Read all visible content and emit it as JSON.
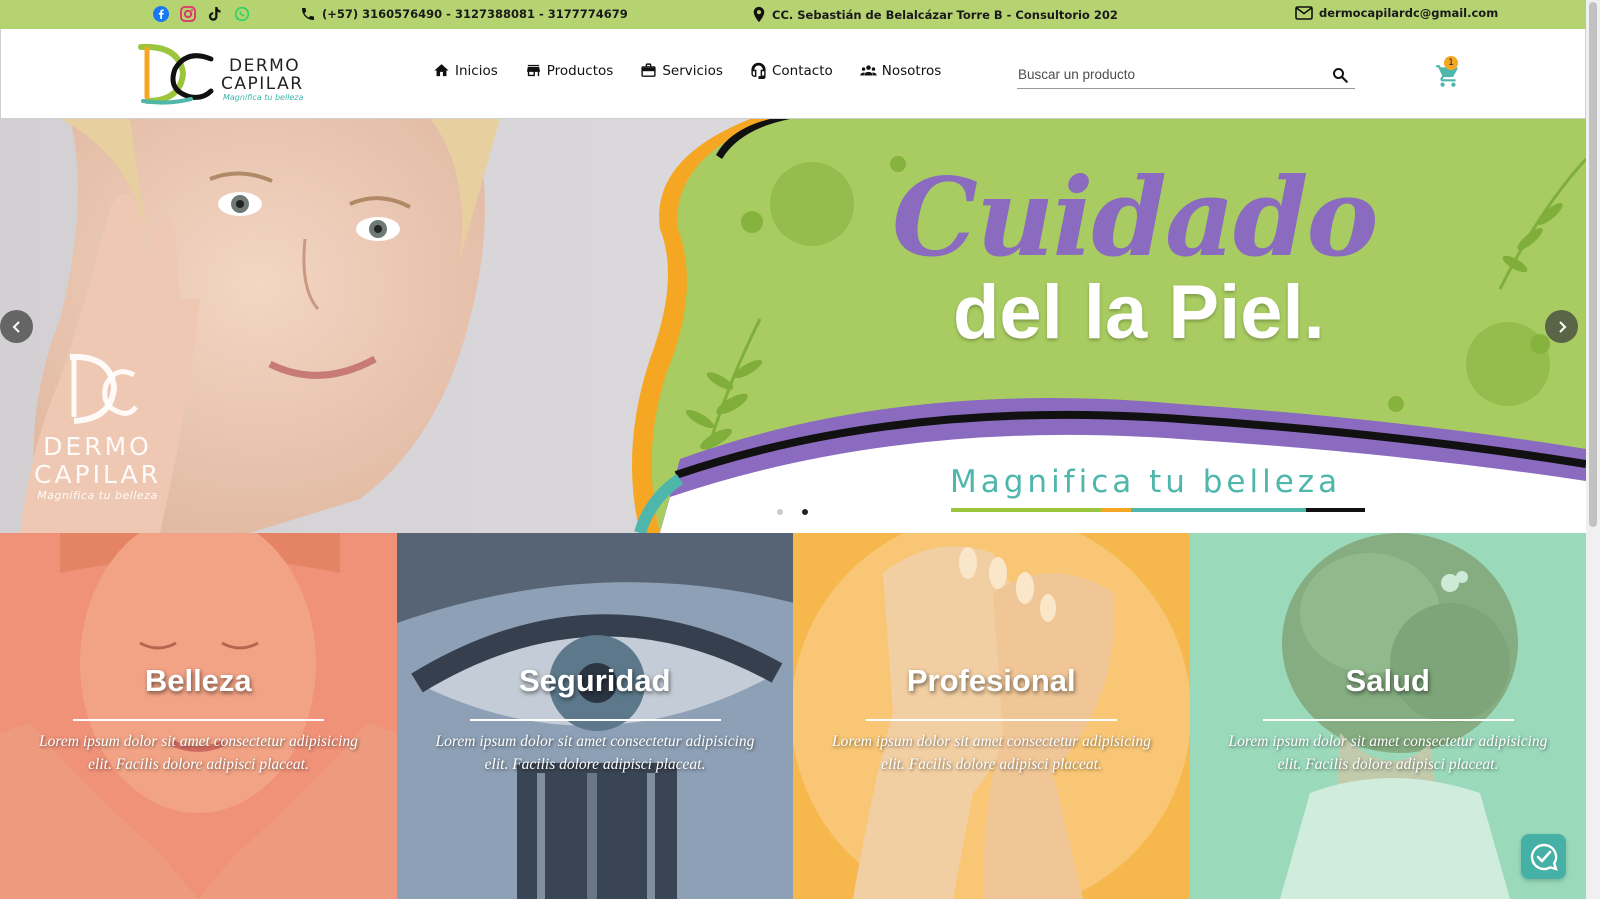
{
  "topbar": {
    "social": [
      "facebook-icon",
      "instagram-icon",
      "tiktok-icon",
      "whatsapp-icon"
    ],
    "phone": "(+57) 3160576490 - 3127388081 - 3177774679",
    "address": "CC. Sebastián de Belalcázar Torre B - Consultorio 202",
    "email": "dermocapilardc@gmail.com"
  },
  "header": {
    "logo": {
      "line1": "DERMO",
      "line2": "CAPILAR",
      "tagline": "Magnifica tu belleza"
    },
    "nav": [
      {
        "label": "Inicios",
        "icon": "home-icon"
      },
      {
        "label": "Productos",
        "icon": "store-icon"
      },
      {
        "label": "Servicios",
        "icon": "briefcase-icon"
      },
      {
        "label": "Contacto",
        "icon": "headset-icon"
      },
      {
        "label": "Nosotros",
        "icon": "group-icon"
      }
    ],
    "search": {
      "placeholder": "Buscar un producto",
      "value": ""
    },
    "cart_count": "1"
  },
  "hero": {
    "script_title": "Cuidado",
    "main_title": "del la Piel.",
    "tagline": "Magnifica tu belleza",
    "watermark": {
      "line1": "DERMO",
      "line2": "CAPILAR",
      "tagline": "Magnifica tu belleza"
    },
    "dots": 2,
    "active_dot": 2
  },
  "categories": [
    {
      "title": "Belleza",
      "text": "Lorem ipsum dolor sit amet consectetur adipisicing elit. Facilis dolore adipisci placeat."
    },
    {
      "title": "Seguridad",
      "text": "Lorem ipsum dolor sit amet consectetur adipisicing elit. Facilis dolore adipisci placeat."
    },
    {
      "title": "Profesional",
      "text": "Lorem ipsum dolor sit amet consectetur adipisicing elit. Facilis dolore adipisci placeat."
    },
    {
      "title": "Salud",
      "text": "Lorem ipsum dolor sit amet consectetur adipisicing elit. Facilis dolore adipisci placeat."
    }
  ],
  "colors": {
    "topbar": "#b6d372",
    "brand_purple": "#8b6bbf",
    "brand_teal": "#4fb6ab",
    "brand_orange": "#f5a623",
    "hero_green": "#a8cc61"
  }
}
